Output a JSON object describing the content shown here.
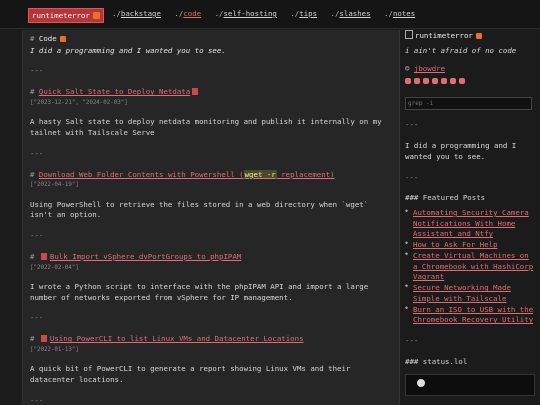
{
  "nav": {
    "brand": "runtimeterror",
    "links": [
      {
        "prefix": "./",
        "label": "backstage",
        "active": false
      },
      {
        "prefix": "./",
        "label": "code",
        "active": true
      },
      {
        "prefix": "./",
        "label": "self-hosting",
        "active": false
      },
      {
        "prefix": "./",
        "label": "tips",
        "active": false
      },
      {
        "prefix": "./",
        "label": "slashes",
        "active": false
      },
      {
        "prefix": "./",
        "label": "notes",
        "active": false
      }
    ]
  },
  "main": {
    "heading_hash": "#",
    "title": "Code",
    "tagline": "I did a programming and I wanted you to see.",
    "separator": "---",
    "posts": [
      {
        "title": "Quick Salt State to Deploy Netdata",
        "dates": "[\"2023-12-21\", \"2024-02-03\"]",
        "summary": "A hasty Salt state to deploy netdata monitoring and publish it internally on my tailnet with Tailscale Serve"
      },
      {
        "title_pre": "Download Web Folder Contents with Powershell (",
        "title_code": "wget -r",
        "title_post": " replacement)",
        "dates": "[\"2022-04-19\"]",
        "summary": "Using PowerShell to retrieve the files stored in a web directory when `wget` isn't an option."
      },
      {
        "title": "Bulk Import vSphere dvPortGroups to phpIPAM",
        "dates": "[\"2022-02-04\"]",
        "summary": "I wrote a Python script to interface with the phpIPAM API and import a large number of networks exported from vSphere for IP management."
      },
      {
        "title": "Using PowerCLI to list Linux VMs and Datacenter Locations",
        "dates": "[\"2022-01-13\"]",
        "summary": "A quick bit of PowerCLI to generate a report showing Linux VMs and their datacenter locations."
      }
    ]
  },
  "sidebar": {
    "title": "runtimeterror",
    "subtitle": "i ain't afraid of no code",
    "user": "jbowdre",
    "search_placeholder": "grep -i",
    "separator": "---",
    "about": "I did a programming and I wanted you to see.",
    "featured_heading": "### Featured Posts",
    "featured": [
      "Automating Security Camera Notifications With Home Assistant and Ntfy",
      "How to Ask For Help",
      "Create Virtual Machines on a Chromebook with HashiCorp Vagrant",
      "Secure Networking Made Simple with Tailscale",
      "Burn an ISO to USB with the Chromebook Recovery Utility"
    ],
    "status_heading": "### status.lol"
  }
}
